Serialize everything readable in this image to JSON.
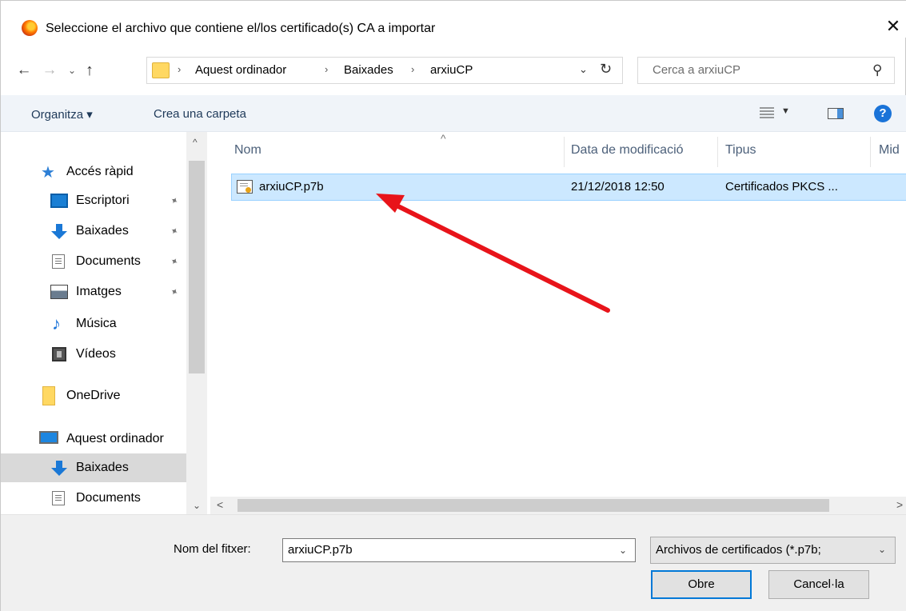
{
  "window": {
    "title": "Seleccione el archivo que contiene el/los certificado(s) CA a importar",
    "close_glyph": "✕"
  },
  "nav": {
    "back": "←",
    "forward": "→",
    "recent": "⌄",
    "up": "↑"
  },
  "address": {
    "crumbs": [
      "Aquest ordinador",
      "Baixades",
      "arxiuCP"
    ],
    "separator": "›",
    "dropdown": "⌄",
    "refresh": "↻"
  },
  "search": {
    "placeholder": "Cerca a arxiuCP",
    "icon": "⚲"
  },
  "toolbar": {
    "organize": "Organitza ▾",
    "new_folder": "Crea una carpeta",
    "view_dd": "▼",
    "help": "?"
  },
  "sidebar": {
    "quick_access": "Accés ràpid",
    "items": [
      {
        "label": "Escriptori",
        "pinned": true,
        "icon": "desktop-icon"
      },
      {
        "label": "Baixades",
        "pinned": true,
        "icon": "download-icon"
      },
      {
        "label": "Documents",
        "pinned": true,
        "icon": "document-icon"
      },
      {
        "label": "Imatges",
        "pinned": true,
        "icon": "pictures-icon"
      },
      {
        "label": "Música",
        "pinned": false,
        "icon": "music-icon"
      },
      {
        "label": "Vídeos",
        "pinned": false,
        "icon": "video-icon"
      }
    ],
    "onedrive": "OneDrive",
    "this_pc": "Aquest ordinador",
    "pc_items": [
      {
        "label": "Baixades",
        "selected": true,
        "icon": "download-icon"
      },
      {
        "label": "Documents",
        "selected": false,
        "icon": "document-icon"
      }
    ],
    "pin_glyph": "📌",
    "scroll_up": "^",
    "scroll_down": "⌄"
  },
  "filelist": {
    "columns": [
      "Nom",
      "Data de modificació",
      "Tipus",
      "Mid"
    ],
    "sort_caret": "^",
    "files": [
      {
        "name": "arxiuCP.p7b",
        "modified": "21/12/2018 12:50",
        "type": "Certificados PKCS ...",
        "selected": true
      }
    ],
    "scroll_left": "<",
    "scroll_right": ">"
  },
  "footer": {
    "filename_label": "Nom del fitxer:",
    "filename_value": "arxiuCP.p7b",
    "filter_value": "Archivos de certificados (*.p7b;",
    "dropdown": "⌄",
    "open_button": "Obre",
    "cancel_button": "Cancel·la"
  },
  "colors": {
    "selection_bg": "#cce8ff",
    "selection_border": "#99d1ff",
    "accent": "#0078d7",
    "annotation_arrow": "#e8141a"
  }
}
